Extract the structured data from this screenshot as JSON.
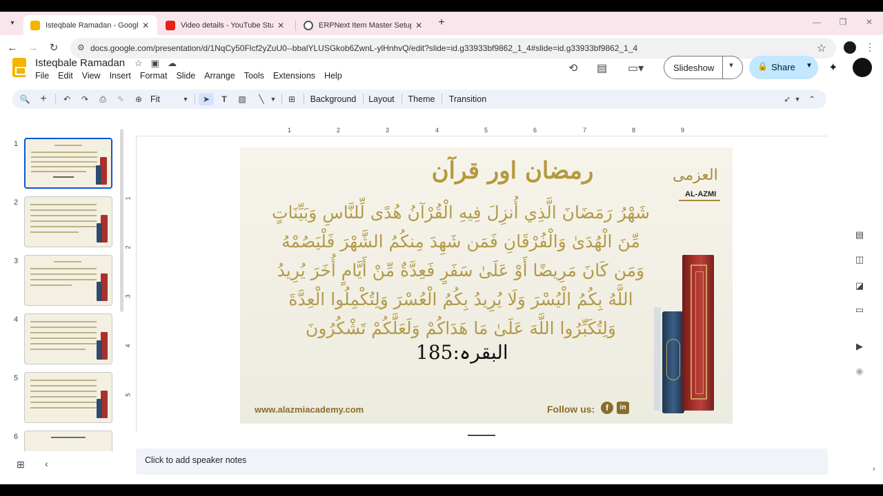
{
  "browser": {
    "tabs": [
      {
        "title": "Isteqbale Ramadan - Google Slides",
        "favicon_color": "#f4b400",
        "active": true
      },
      {
        "title": "Video details - YouTube Studio",
        "favicon_color": "#e62117",
        "active": false
      },
      {
        "title": "ERPNext Item Master Setup",
        "favicon_color": "#555555",
        "active": false
      }
    ],
    "new_tab": "+",
    "url": "docs.google.com/presentation/d/1NqCy50Flcf2yZuU0--bbalYLUSGkob6ZwnL-ylHnhvQ/edit?slide=id.g33933bf9862_1_4#slide=id.g33933bf9862_1_4"
  },
  "app": {
    "doc_title": "Isteqbale Ramadan",
    "menu": [
      "File",
      "Edit",
      "View",
      "Insert",
      "Format",
      "Slide",
      "Arrange",
      "Tools",
      "Extensions",
      "Help"
    ],
    "slideshow_label": "Slideshow",
    "share_label": "Share"
  },
  "toolbar": {
    "zoom": "Fit",
    "background": "Background",
    "layout": "Layout",
    "theme": "Theme",
    "transition": "Transition"
  },
  "filmstrip": {
    "numbers": [
      "1",
      "2",
      "3",
      "4",
      "5",
      "6"
    ]
  },
  "ruler": {
    "h": [
      "1",
      "2",
      "3",
      "4",
      "5",
      "6",
      "7",
      "8",
      "9"
    ],
    "v": [
      "1",
      "2",
      "3",
      "4",
      "5"
    ]
  },
  "slide": {
    "title": "رمضان اور قرآن",
    "verse_lines": [
      "شَهْرُ رَمَضَانَ الَّذِي أُنزِلَ فِيهِ الْقُرْآنُ هُدًى لِّلنَّاسِ وَبَيِّنَاتٍ",
      "مِّنَ الْهُدَىٰ وَالْفُرْقَانِ فَمَن شَهِدَ مِنكُمُ الشَّهْرَ فَلْيَصُمْهُ",
      "وَمَن كَانَ مَرِيضًا أَوْ عَلَىٰ سَفَرٍ فَعِدَّةٌ مِّنْ أَيَّامٍ أُخَرَ يُرِيدُ",
      "اللَّهُ بِكُمُ الْيُسْرَ وَلَا يُرِيدُ بِكُمُ الْعُسْرَ وَلِتُكْمِلُوا الْعِدَّةَ",
      "وَلِتُكَبِّرُوا اللَّهَ عَلَىٰ مَا هَدَاكُمْ وَلَعَلَّكُمْ تَشْكُرُونَ"
    ],
    "reference": "البقرہ:185",
    "website": "www.alazmiacademy.com",
    "follow": "Follow us:",
    "logo_ar": "العزمی",
    "logo_en": "AL-AZMI",
    "accent_color": "#b39a48"
  },
  "notes": {
    "placeholder": "Click to add speaker notes"
  }
}
